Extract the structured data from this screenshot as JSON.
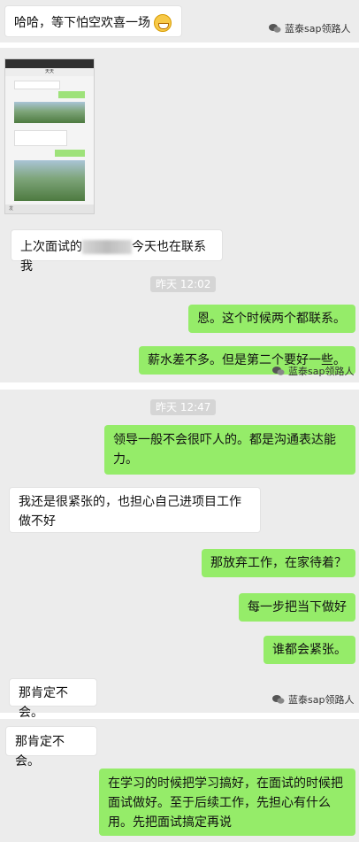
{
  "messages": [
    {
      "id": "m1",
      "dir": "in",
      "text": "哈哈，等下怕空欢喜一场"
    },
    {
      "id": "m2",
      "dir": "in",
      "prefix": "上次面试的",
      "suffix": "今天也在联系我"
    },
    {
      "id": "m3",
      "dir": "out",
      "text": "恩。这个时候两个都联系。"
    },
    {
      "id": "m4",
      "dir": "out",
      "text": "薪水差不多。但是第二个要好一些。"
    },
    {
      "id": "m5",
      "dir": "out",
      "text": "领导一般不会很吓人的。都是沟通表达能力。"
    },
    {
      "id": "m6",
      "dir": "in",
      "text": "我还是很紧张的，也担心自己进项目工作做不好"
    },
    {
      "id": "m7",
      "dir": "out",
      "text": "那放弃工作，在家待着？"
    },
    {
      "id": "m8",
      "dir": "out",
      "text": "每一步把当下做好"
    },
    {
      "id": "m9",
      "dir": "out",
      "text": "谁都会紧张。"
    },
    {
      "id": "m10",
      "dir": "in",
      "text": "那肯定不会。"
    },
    {
      "id": "m11",
      "dir": "in",
      "text": "那肯定不会。"
    },
    {
      "id": "m12",
      "dir": "out",
      "text": "在学习的时候把学习搞好，在面试的时候把面试做好。至于后续工作，先担心有什么用。先把面试搞定再说"
    }
  ],
  "timestamps": {
    "t1": "昨天 12:02",
    "t2": "昨天 12:47"
  },
  "watermark": "蓝泰sap领路人",
  "thumbnail": {
    "title": "天天",
    "reply_placeholder": "发"
  },
  "colors": {
    "outgoing": "#95ec69",
    "incoming": "#ffffff",
    "panel": "#ececec"
  },
  "emoji": "grinning-face"
}
